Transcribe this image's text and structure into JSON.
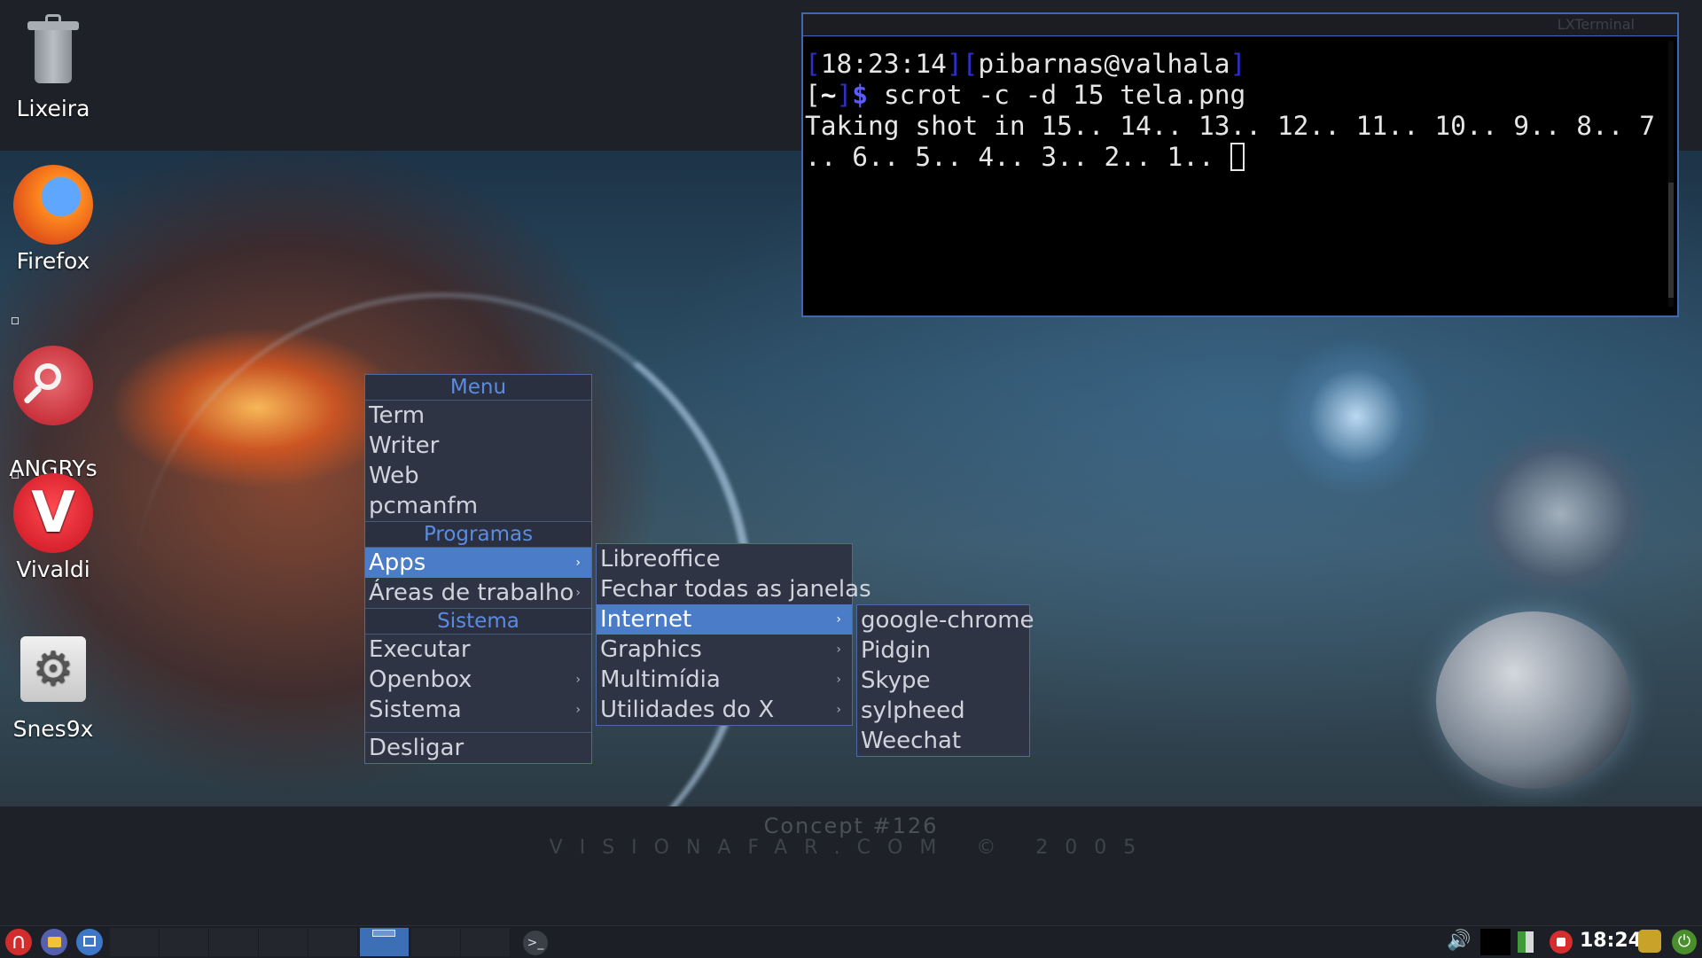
{
  "desktop": {
    "icons": [
      {
        "label": "Lixeira"
      },
      {
        "label": "Firefox"
      },
      {
        "label": "ANGRYs\nearch"
      },
      {
        "label": "Vivaldi"
      },
      {
        "label": "Snes9x"
      }
    ],
    "wallpaper_caption": {
      "line1": "Concept #126",
      "line2": "VISIONAFAR.COM  © 2005"
    }
  },
  "terminal": {
    "title": "LXTerminal",
    "prompt_time": "18:23:14",
    "prompt_user": "pibarnas@valhala",
    "prompt_dir": "~",
    "prompt_symbol": "$",
    "command": " scrot -c -d 15 tela.png",
    "output_line1": "Taking shot in 15.. 14.. 13.. 12.. 11.. 10.. 9.. 8.. 7",
    "output_line2": ".. 6.. 5.. 4.. 3.. 2.. 1.. "
  },
  "root_menu": {
    "header": "Menu",
    "items_top": [
      "Term",
      "Writer",
      "Web",
      "pcmanfm"
    ],
    "programs_header": "Programas",
    "apps": "Apps",
    "workspaces": "Áreas de trabalho",
    "system_header": "Sistema",
    "run": "Executar",
    "openbox": "Openbox",
    "system": "Sistema",
    "shutdown": "Desligar"
  },
  "apps_menu": {
    "libreoffice": "Libreoffice",
    "close_all": "Fechar todas as janelas",
    "internet": "Internet",
    "graphics": "Graphics",
    "multimedia": "Multimídia",
    "x_utils": "Utilidades do X"
  },
  "internet_menu": {
    "items": [
      "google-chrome",
      "Pidgin",
      "Skype",
      "sylpheed",
      "Weechat"
    ]
  },
  "taskbar": {
    "start_icon": "debian-swirl-icon",
    "workspaces_count": 8,
    "active_workspace": 6,
    "clock": "18:24"
  }
}
